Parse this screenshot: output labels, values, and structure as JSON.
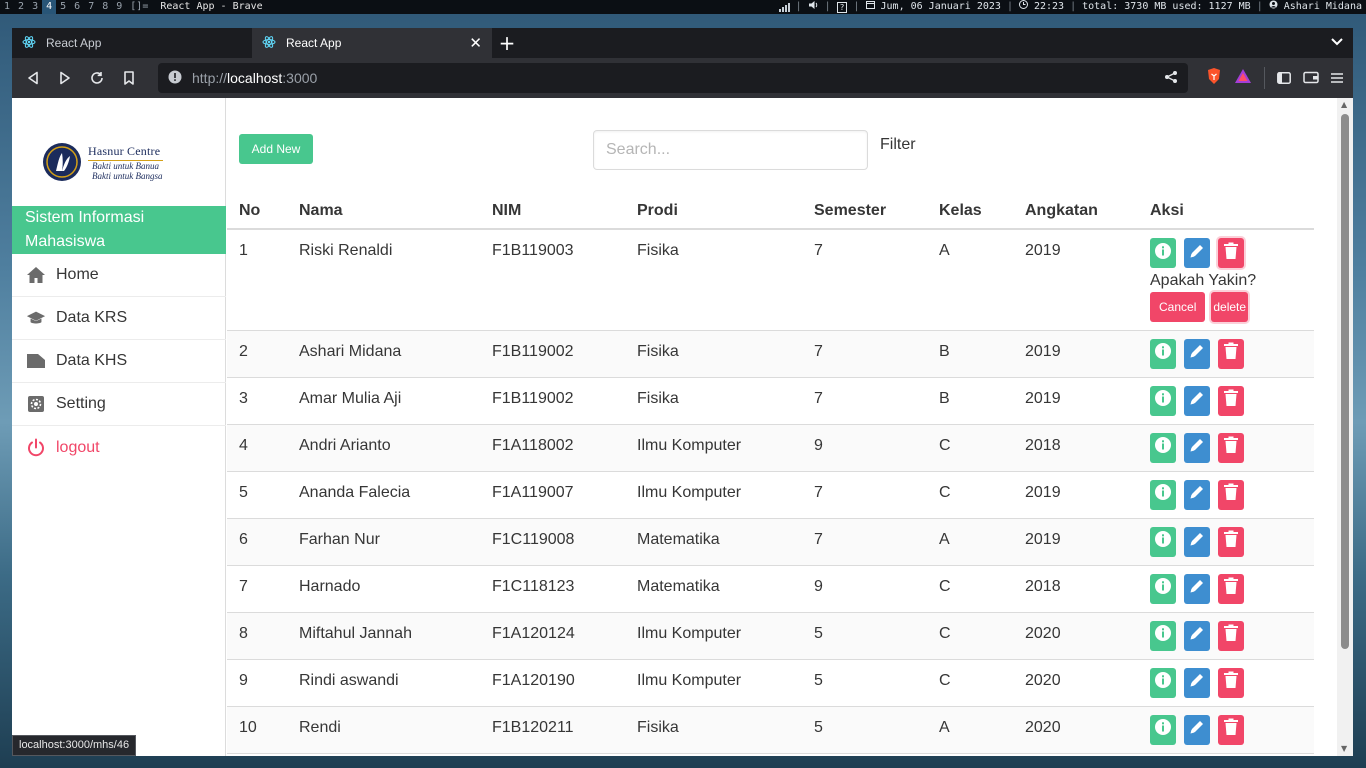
{
  "wm": {
    "workspaces": [
      "1",
      "2",
      "3",
      "4",
      "5",
      "6",
      "7",
      "8",
      "9"
    ],
    "layout": "[]=",
    "window_title": "React App - Brave",
    "date": "Jum, 06 Januari 2023",
    "time": "22:23",
    "memory": "total: 3730 MB used: 1127 MB",
    "user": "Ashari Midana"
  },
  "browser": {
    "tabs": [
      {
        "title": "React App"
      },
      {
        "title": "React App"
      }
    ],
    "url_scheme": "http://",
    "url_host": "localhost",
    "url_port": ":3000",
    "status_link": "localhost:3000/mhs/46"
  },
  "sidebar": {
    "logo_name": "Hasnur Centre",
    "logo_tag1": "Bakti untuk Banua",
    "logo_tag2": "Bakti untuk Bangsa",
    "title_line1": "Sistem Informasi",
    "title_line2": "Mahasiswa",
    "items": [
      {
        "label": "Home",
        "icon": "home-icon"
      },
      {
        "label": "Data KRS",
        "icon": "graduation-cap-icon"
      },
      {
        "label": "Data KHS",
        "icon": "folder-icon"
      },
      {
        "label": "Setting",
        "icon": "gear-icon"
      },
      {
        "label": "logout",
        "icon": "power-icon"
      }
    ]
  },
  "toolbar": {
    "add_label": "Add New",
    "search_placeholder": "Search...",
    "filter_label": "Filter"
  },
  "table": {
    "headers": [
      "No",
      "Nama",
      "NIM",
      "Prodi",
      "Semester",
      "Kelas",
      "Angkatan",
      "Aksi"
    ],
    "rows": [
      [
        "1",
        "Riski Renaldi",
        "F1B119003",
        "Fisika",
        "7",
        "A",
        "2019"
      ],
      [
        "2",
        "Ashari Midana",
        "F1B119002",
        "Fisika",
        "7",
        "B",
        "2019"
      ],
      [
        "3",
        "Amar Mulia Aji",
        "F1B119002",
        "Fisika",
        "7",
        "B",
        "2019"
      ],
      [
        "4",
        "Andri Arianto",
        "F1A118002",
        "Ilmu Komputer",
        "9",
        "C",
        "2018"
      ],
      [
        "5",
        "Ananda Falecia",
        "F1A119007",
        "Ilmu Komputer",
        "7",
        "C",
        "2019"
      ],
      [
        "6",
        "Farhan Nur",
        "F1C119008",
        "Matematika",
        "7",
        "A",
        "2019"
      ],
      [
        "7",
        "Harnado",
        "F1C118123",
        "Matematika",
        "9",
        "C",
        "2018"
      ],
      [
        "8",
        "Miftahul Jannah",
        "F1A120124",
        "Ilmu Komputer",
        "5",
        "C",
        "2020"
      ],
      [
        "9",
        "Rindi aswandi",
        "F1A120190",
        "Ilmu Komputer",
        "5",
        "C",
        "2020"
      ],
      [
        "10",
        "Rendi",
        "F1B120211",
        "Fisika",
        "5",
        "A",
        "2020"
      ]
    ],
    "confirm": {
      "question": "Apakah Yakin?",
      "cancel_label": "Cancel",
      "delete_label": "delete"
    }
  },
  "colors": {
    "primary_green": "#48c78e",
    "info_blue": "#3e8ed0",
    "danger_red": "#f14668"
  }
}
